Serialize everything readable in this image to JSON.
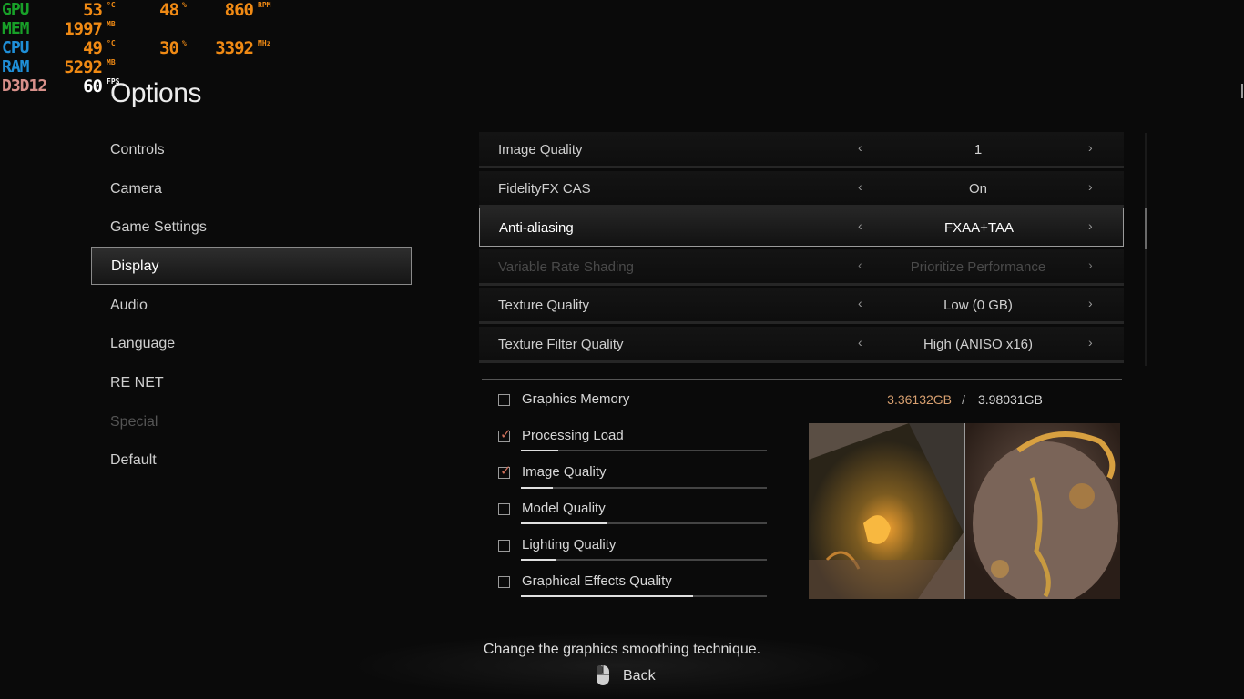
{
  "overlay": {
    "gpu": {
      "label": "GPU",
      "temp": "53",
      "temp_unit": "°C",
      "load": "48",
      "load_unit": "%",
      "fan": "860",
      "fan_unit": "RPM"
    },
    "mem": {
      "label": "MEM",
      "value": "1997",
      "unit": "MB"
    },
    "cpu": {
      "label": "CPU",
      "temp": "49",
      "temp_unit": "°C",
      "load": "30",
      "load_unit": "%",
      "clock": "3392",
      "clock_unit": "MHz"
    },
    "ram": {
      "label": "RAM",
      "value": "5292",
      "unit": "MB"
    },
    "api": {
      "label": "D3D12",
      "fps": "60",
      "fps_unit": "FPS"
    }
  },
  "page": {
    "title": "Options"
  },
  "menu": [
    {
      "label": "Controls",
      "state": "normal"
    },
    {
      "label": "Camera",
      "state": "normal"
    },
    {
      "label": "Game Settings",
      "state": "normal"
    },
    {
      "label": "Display",
      "state": "active"
    },
    {
      "label": "Audio",
      "state": "normal"
    },
    {
      "label": "Language",
      "state": "normal"
    },
    {
      "label": "RE NET",
      "state": "normal"
    },
    {
      "label": "Special",
      "state": "disabled"
    },
    {
      "label": "Default",
      "state": "normal"
    }
  ],
  "settings": [
    {
      "label": "Image Quality",
      "value": "1",
      "state": "normal"
    },
    {
      "label": "FidelityFX CAS",
      "value": "On",
      "state": "normal"
    },
    {
      "label": "Anti-aliasing",
      "value": "FXAA+TAA",
      "state": "active"
    },
    {
      "label": "Variable Rate Shading",
      "value": "Prioritize Performance",
      "state": "disabled"
    },
    {
      "label": "Texture Quality",
      "value": "Low (0 GB)",
      "state": "normal"
    },
    {
      "label": "Texture Filter Quality",
      "value": "High (ANISO x16)",
      "state": "normal"
    }
  ],
  "arrows": {
    "left": "‹",
    "right": "›"
  },
  "graphics_memory": {
    "label": "Graphics Memory",
    "checked": false,
    "used": "3.36132GB",
    "separator": "/",
    "total": "3.98031GB"
  },
  "load_items": [
    {
      "label": "Processing Load",
      "checked": true,
      "level": 0.15
    },
    {
      "label": "Image Quality",
      "checked": true,
      "level": 0.13
    },
    {
      "label": "Model Quality",
      "checked": false,
      "level": 0.35
    },
    {
      "label": "Lighting Quality",
      "checked": false,
      "level": 0.14
    },
    {
      "label": "Graphical Effects Quality",
      "checked": false,
      "level": 0.7
    }
  ],
  "footer": {
    "hint": "Change the graphics smoothing technique.",
    "back_label": "Back",
    "back_icon": "mouse-icon"
  },
  "colors": {
    "accent_orange": "#f08a14",
    "memory_used": "#d8a070",
    "check_tick": "#d0705a"
  }
}
